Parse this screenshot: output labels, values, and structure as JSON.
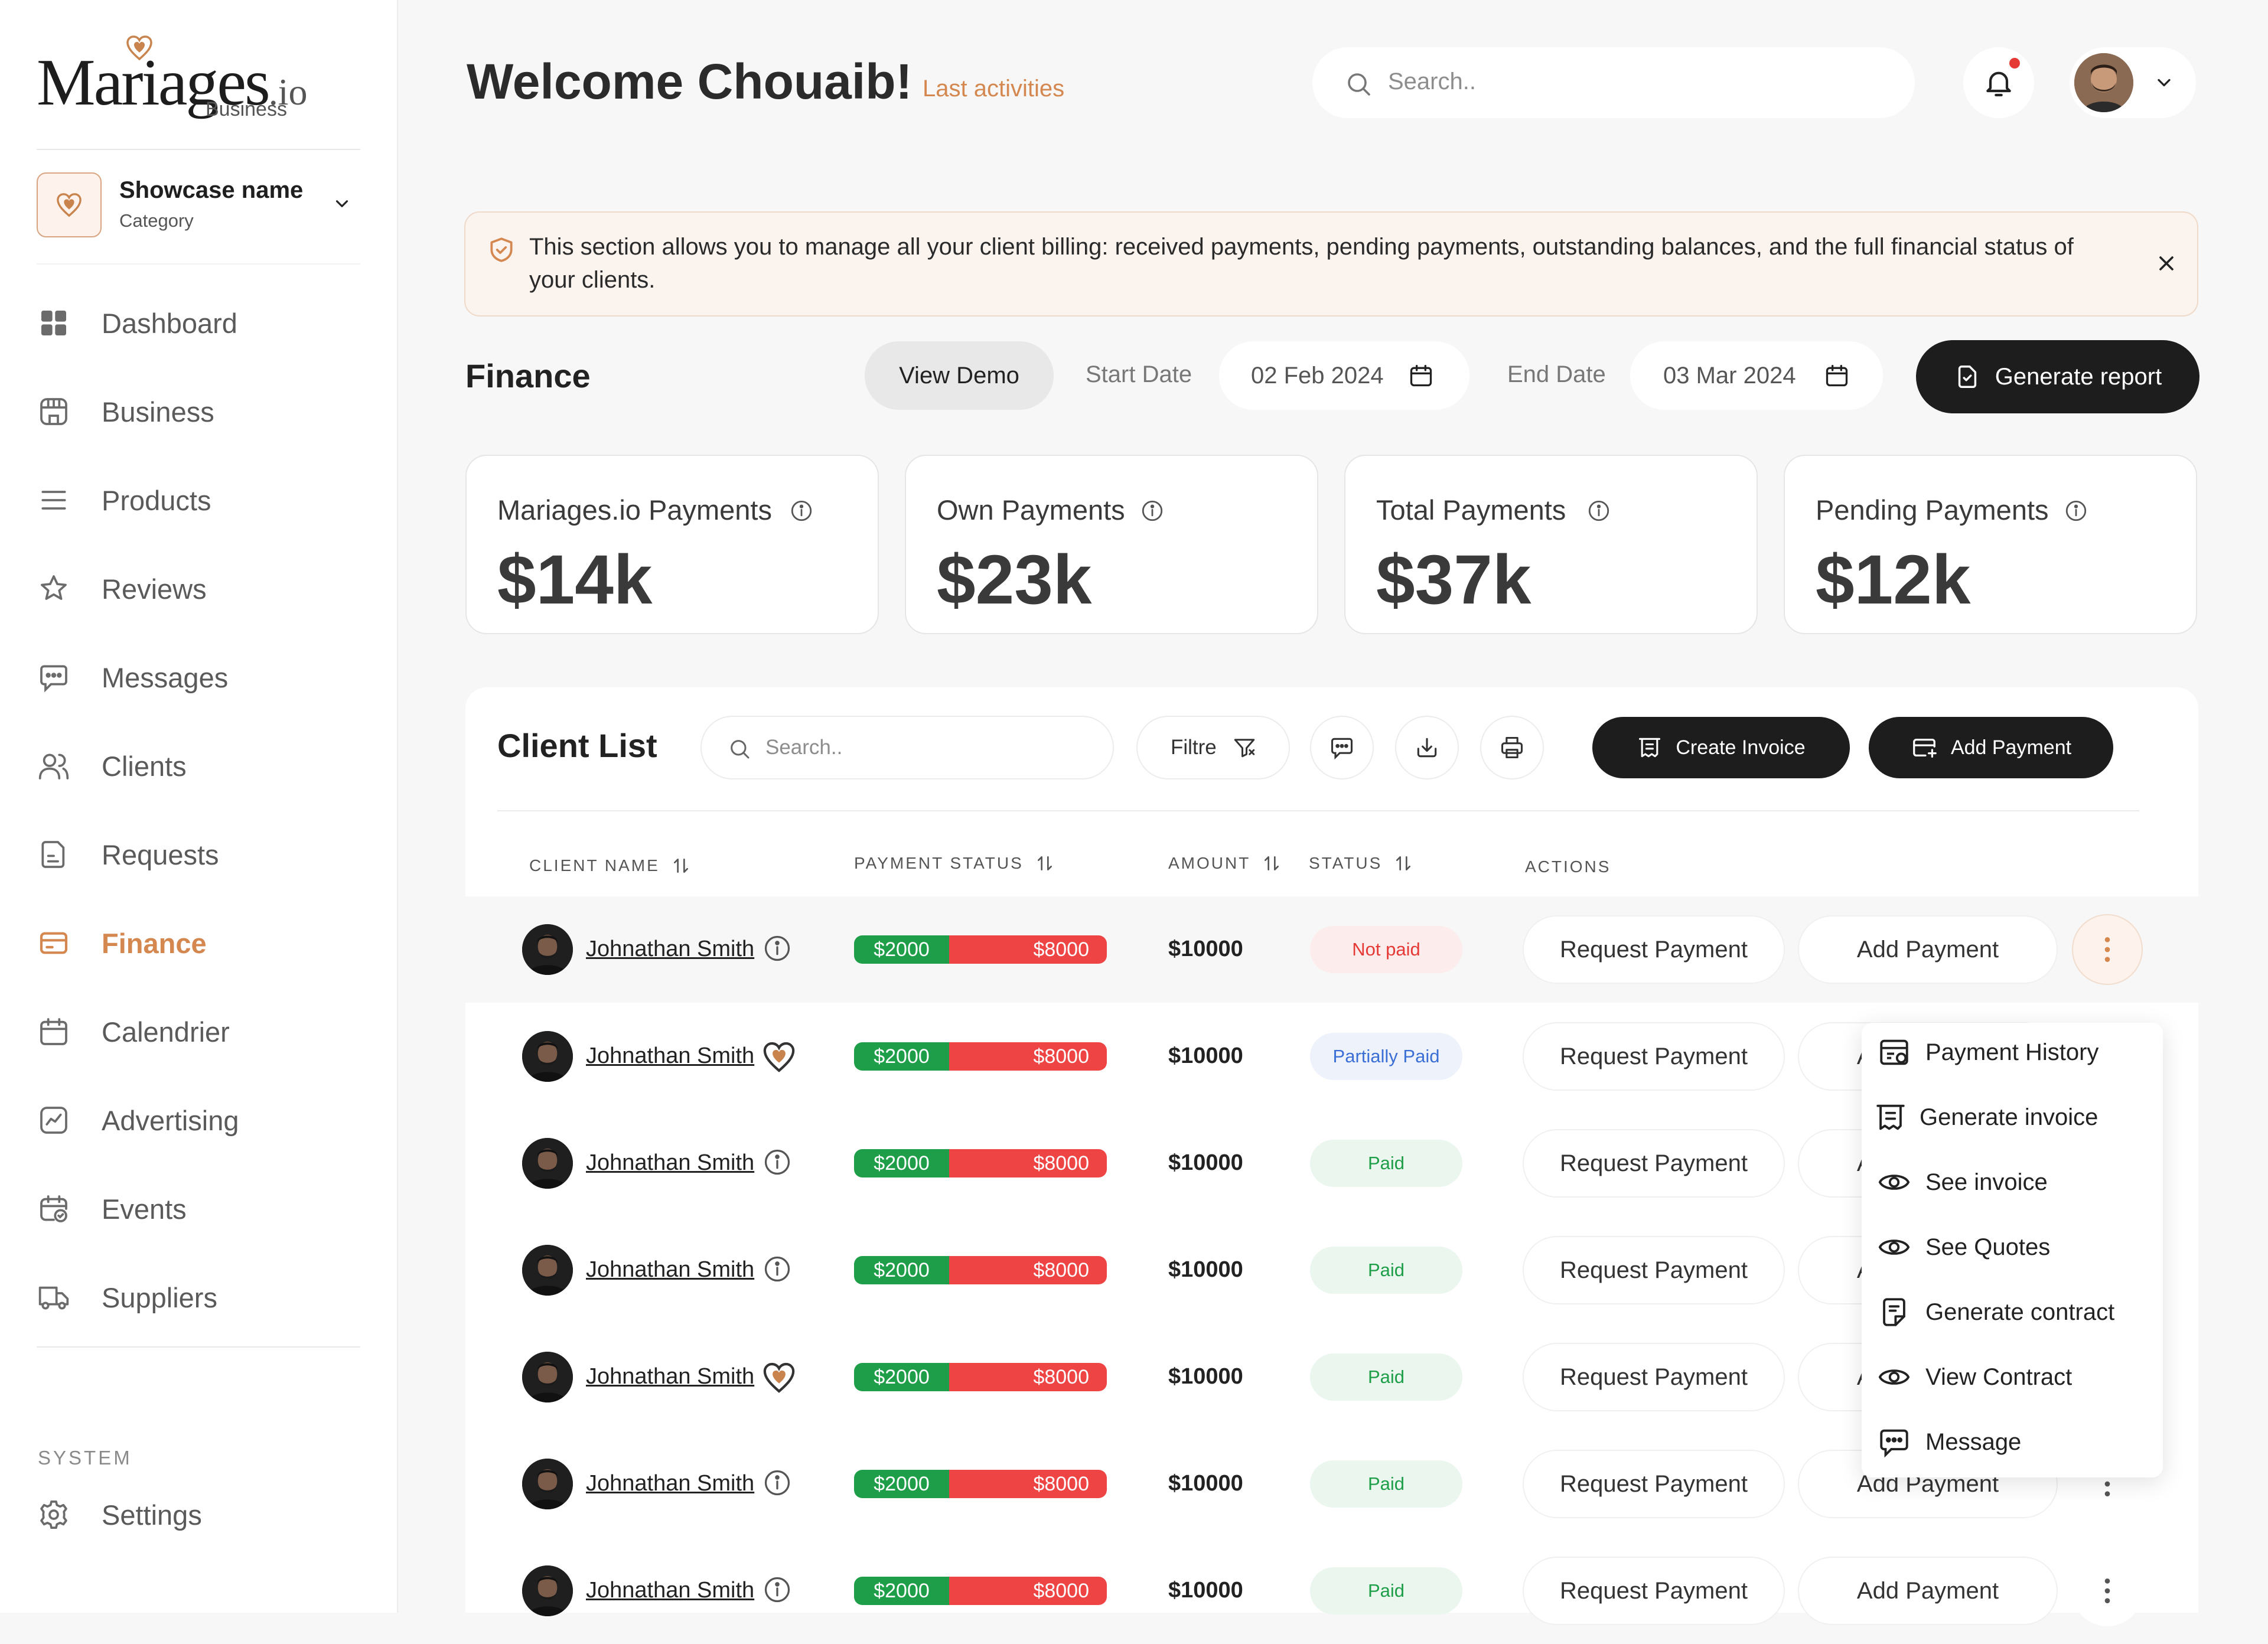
{
  "brand": {
    "name": "Mariages",
    "tld": ".io",
    "sub": "Business",
    "accent": "#d4874f"
  },
  "showcase": {
    "name": "Showcase name",
    "category": "Category"
  },
  "nav": {
    "items": [
      {
        "label": "Dashboard",
        "icon": "dashboard-icon"
      },
      {
        "label": "Business",
        "icon": "store-icon"
      },
      {
        "label": "Products",
        "icon": "menu-lines-icon"
      },
      {
        "label": "Reviews",
        "icon": "star-icon"
      },
      {
        "label": "Messages",
        "icon": "chat-icon"
      },
      {
        "label": "Clients",
        "icon": "users-icon"
      },
      {
        "label": "Requests",
        "icon": "document-icon"
      },
      {
        "label": "Finance",
        "icon": "card-icon",
        "active": true
      },
      {
        "label": "Calendrier",
        "icon": "calendar-icon"
      },
      {
        "label": "Advertising",
        "icon": "chart-icon"
      },
      {
        "label": "Events",
        "icon": "event-icon"
      },
      {
        "label": "Suppliers",
        "icon": "truck-icon"
      }
    ],
    "system_label": "SYSTEM",
    "settings_label": "Settings"
  },
  "header": {
    "welcome": "Welcome Chouaib!",
    "last_activities": "Last activities",
    "search_placeholder": "Search.."
  },
  "banner": {
    "text": "This section allows you to manage all your client billing: received payments, pending payments, outstanding balances, and the full financial status of your clients."
  },
  "finance": {
    "title": "Finance",
    "view_demo": "View Demo",
    "start_label": "Start Date",
    "start_value": "02 Feb 2024",
    "end_label": "End Date",
    "end_value": "03 Mar 2024",
    "generate_report": "Generate report"
  },
  "stats": [
    {
      "title": "Mariages.io Payments",
      "value": "$14k"
    },
    {
      "title": "Own Payments",
      "value": "$23k"
    },
    {
      "title": "Total Payments",
      "value": "$37k"
    },
    {
      "title": "Pending Payments",
      "value": "$12k"
    }
  ],
  "client_list": {
    "title": "Client List",
    "search_placeholder": "Search..",
    "filter_label": "Filtre",
    "create_invoice": "Create Invoice",
    "add_payment": "Add Payment",
    "columns": [
      "CLIENT NAME",
      "PAYMENT STATUS",
      "AMOUNT",
      "STATUS",
      "ACTIONS"
    ],
    "rows": [
      {
        "name": "Johnathan Smith",
        "mark": "info",
        "paid": "$2000",
        "due": "$8000",
        "paid_fraction": 0.2,
        "amount": "$10000",
        "status": "Not paid",
        "kind": "notpaid"
      },
      {
        "name": "Johnathan Smith",
        "mark": "heart",
        "paid": "$2000",
        "due": "$8000",
        "paid_fraction": 0.2,
        "amount": "$10000",
        "status": "Partially Paid",
        "kind": "partial"
      },
      {
        "name": "Johnathan Smith",
        "mark": "info",
        "paid": "$2000",
        "due": "$8000",
        "paid_fraction": 0.2,
        "amount": "$10000",
        "status": "Paid",
        "kind": "paid"
      },
      {
        "name": "Johnathan Smith",
        "mark": "info",
        "paid": "$2000",
        "due": "$8000",
        "paid_fraction": 0.2,
        "amount": "$10000",
        "status": "Paid",
        "kind": "paid"
      },
      {
        "name": "Johnathan Smith",
        "mark": "heart",
        "paid": "$2000",
        "due": "$8000",
        "paid_fraction": 0.2,
        "amount": "$10000",
        "status": "Paid",
        "kind": "paid"
      },
      {
        "name": "Johnathan Smith",
        "mark": "info",
        "paid": "$2000",
        "due": "$8000",
        "paid_fraction": 0.2,
        "amount": "$10000",
        "status": "Paid",
        "kind": "paid"
      },
      {
        "name": "Johnathan Smith",
        "mark": "info",
        "paid": "$2000",
        "due": "$8000",
        "paid_fraction": 0.2,
        "amount": "$10000",
        "status": "Paid",
        "kind": "paid"
      }
    ],
    "request_payment": "Request Payment",
    "row_add_payment": "Add Payment"
  },
  "menu": {
    "items": [
      {
        "label": "Payment History",
        "icon": "history-icon"
      },
      {
        "label": "Generate invoice",
        "icon": "invoice-icon"
      },
      {
        "label": "See invoice",
        "icon": "eye-icon"
      },
      {
        "label": "See Quotes",
        "icon": "eye-icon"
      },
      {
        "label": "Generate contract",
        "icon": "contract-icon"
      },
      {
        "label": "View Contract",
        "icon": "eye-icon"
      },
      {
        "label": "Message",
        "icon": "chat-icon"
      }
    ]
  }
}
